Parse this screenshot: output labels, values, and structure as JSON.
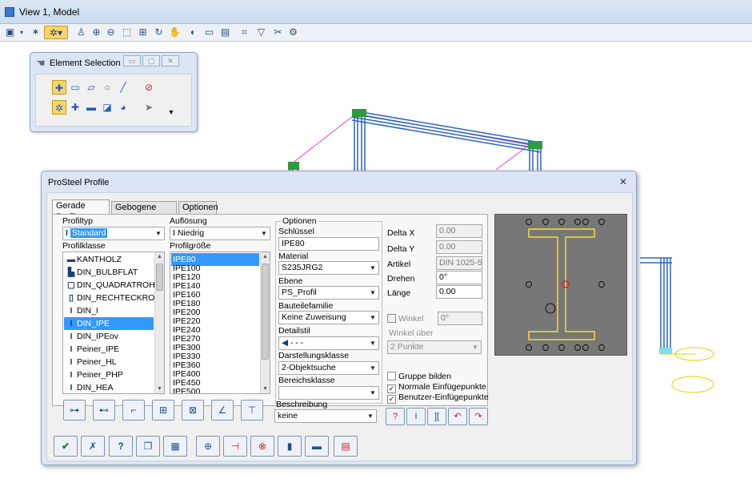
{
  "window": {
    "title": "View 1, Model"
  },
  "toolbar": {
    "icons": [
      "view-attributes-icon",
      "dropdown-icon",
      "view-display-icon",
      "element-selection-icon",
      "dropdown-icon",
      "update-view-icon",
      "zoom-in-icon",
      "zoom-out-icon",
      "window-area-icon",
      "fit-view-icon",
      "rotate-view-icon",
      "pan-icon",
      "view-previous-icon",
      "view-next-icon",
      "copy-view-icon",
      "camera-icon",
      "clip-volume-icon",
      "clip-mask-icon",
      "view-toggles-icon"
    ]
  },
  "element_selection": {
    "title": "Element Selection",
    "tools_row1": [
      "individual-select-icon",
      "block-select-icon",
      "shape-select-icon",
      "circle-select-icon",
      "line-select-icon",
      "clear-selection-icon"
    ],
    "tools_row2": [
      "new-mode-icon",
      "add-mode-icon",
      "subtract-mode-icon",
      "invert-mode-icon",
      "global-mode-icon",
      "pointer-icon",
      "expand-icon"
    ]
  },
  "prosteel": {
    "title": "ProSteel Profile",
    "tabs": [
      "Gerade Profile",
      "Gebogene Profile",
      "Optionen"
    ],
    "profiltyp_label": "Profiltyp",
    "profiltyp_value": "Standard",
    "aufloesung_label": "Auflösung",
    "aufloesung_value": "Niedrig",
    "profilklasse_label": "Profilklasse",
    "profilklasse_items": [
      "KANTHOLZ",
      "DIN_BULBFLAT",
      "DIN_QUADRATROHR",
      "DIN_RECHTECKROHR",
      "DIN_I",
      "DIN_IPE",
      "DIN_IPEov",
      "Peiner_IPE",
      "Peiner_HL",
      "Peiner_PHP",
      "DIN_HEA"
    ],
    "profilklasse_selected": "DIN_IPE",
    "profilgroesse_label": "Profilgröße",
    "profilgroesse_items": [
      "IPE80",
      "IPE100",
      "IPE120",
      "IPE140",
      "IPE160",
      "IPE180",
      "IPE200",
      "IPE220",
      "IPE240",
      "IPE270",
      "IPE300",
      "IPE330",
      "IPE360",
      "IPE400",
      "IPE450",
      "IPE500"
    ],
    "profilgroesse_selected": "IPE80",
    "optionen": {
      "group_label": "Optionen",
      "schluessel_label": "Schlüssel",
      "schluessel_value": "IPE80",
      "material_label": "Material",
      "material_value": "S235JRG2",
      "ebene_label": "Ebene",
      "ebene_value": "PS_Profil",
      "bauteilefamilie_label": "Bauteilefamilie",
      "bauteilefamilie_value": "Keine Zuweisung",
      "detailstil_label": "Detailstil",
      "detailstil_value": "- - -",
      "darstellungsklasse_label": "Darstellungsklasse",
      "darstellungsklasse_value": "2-Objektsuche",
      "bereichsklasse_label": "Bereichsklasse",
      "bereichsklasse_value": "",
      "beschreibung_label": "Beschreibung",
      "beschreibung_value": "keine"
    },
    "delta_x_label": "Delta X",
    "delta_x_value": "0.00",
    "delta_y_label": "Delta Y",
    "delta_y_value": "0.00",
    "artikel_label": "Artikel",
    "artikel_value": "DIN 1025-5",
    "drehen_label": "Drehen",
    "drehen_value": "0°",
    "laenge_label": "Länge",
    "laenge_value": "0.00",
    "winkel_label": "Winkel",
    "winkel_value": "0°",
    "winkel_ueber_label": "Winkel über",
    "winkel_ueber_value": "2 Punkte",
    "gruppe_bilden_label": "Gruppe bilden",
    "normale_label": "Normale Einfügepunkte",
    "benutzer_label": "Benutzer-Einfügepunkte",
    "checks": {
      "winkel": false,
      "gruppe_bilden": false,
      "normale": true,
      "benutzer": true
    },
    "check_glyph": "✓",
    "insert_buttons": [
      "insert-center-icon",
      "insert-flange-icon",
      "insert-corner-icon",
      "insert-web-icon",
      "insert-multi-icon",
      "insert-angle-icon",
      "insert-axis-icon"
    ],
    "right_buttons": [
      "help-profile-icon",
      "profile-view-icon",
      "mirror-icon",
      "rotate-left-icon",
      "rotate-right-icon"
    ],
    "footer_buttons": [
      "ok-check-icon",
      "cancel-icon",
      "help-icon",
      "copy-doc-icon",
      "properties-icon",
      "add-profile-icon",
      "split-icon",
      "cut-icon",
      "beam-icon",
      "column-icon",
      "report-icon"
    ]
  },
  "colors": {
    "accent": "#3399ff",
    "profile_yellow": "#f2e12a",
    "model_blue": "#2a64c7",
    "magenta": "#e040e0"
  }
}
